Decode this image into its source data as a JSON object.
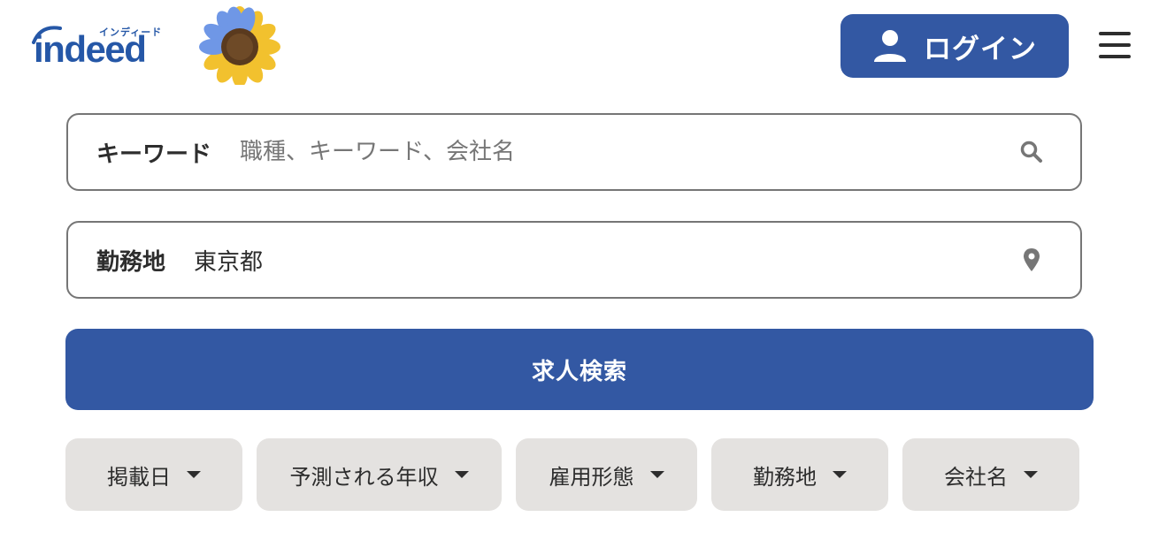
{
  "header": {
    "logo": {
      "word": "indeed",
      "kana": "インディード",
      "color": "#2557a7"
    },
    "decoration": "sunflower-emblem",
    "login_label": "ログイン",
    "menu_icon": "hamburger-menu-icon"
  },
  "search": {
    "keyword": {
      "label": "キーワード",
      "value": "",
      "placeholder": "職種、キーワード、会社名",
      "icon": "search-icon"
    },
    "location": {
      "label": "勤務地",
      "value": "東京都",
      "placeholder": "",
      "icon": "location-pin-icon"
    },
    "submit_label": "求人検索"
  },
  "filters": [
    {
      "label": "掲載日"
    },
    {
      "label": "予測される年収"
    },
    {
      "label": "雇用形態"
    },
    {
      "label": "勤務地"
    },
    {
      "label": "会社名"
    }
  ],
  "colors": {
    "primary": "#3358a3",
    "field_border": "#767676",
    "filter_bg": "#e4e2e0",
    "text": "#2d2d2d"
  }
}
